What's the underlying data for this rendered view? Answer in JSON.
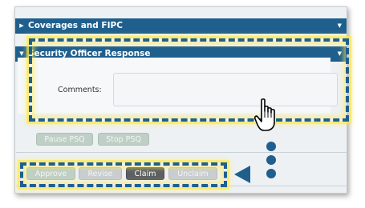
{
  "sections": [
    {
      "label": "Coverages and FIPC",
      "expanded": false
    },
    {
      "label": "Security Officer Response",
      "expanded": true
    }
  ],
  "comments": {
    "label": "Comments:",
    "value": "",
    "placeholder": ""
  },
  "psq_buttons": {
    "pause": "Pause PSQ",
    "stop": "Stop PSQ"
  },
  "actions": {
    "approve": "Approve",
    "revise": "Revise",
    "claim": "Claim",
    "unclaim": "Unclaim"
  },
  "icons": {
    "collapsed": "caret-right-icon",
    "expanded": "caret-down-icon",
    "cursor": "hand-pointer-icon"
  },
  "colors": {
    "header": "#1f5f8e",
    "highlight": "#ffe83c",
    "claim_button": "#5d6063"
  }
}
